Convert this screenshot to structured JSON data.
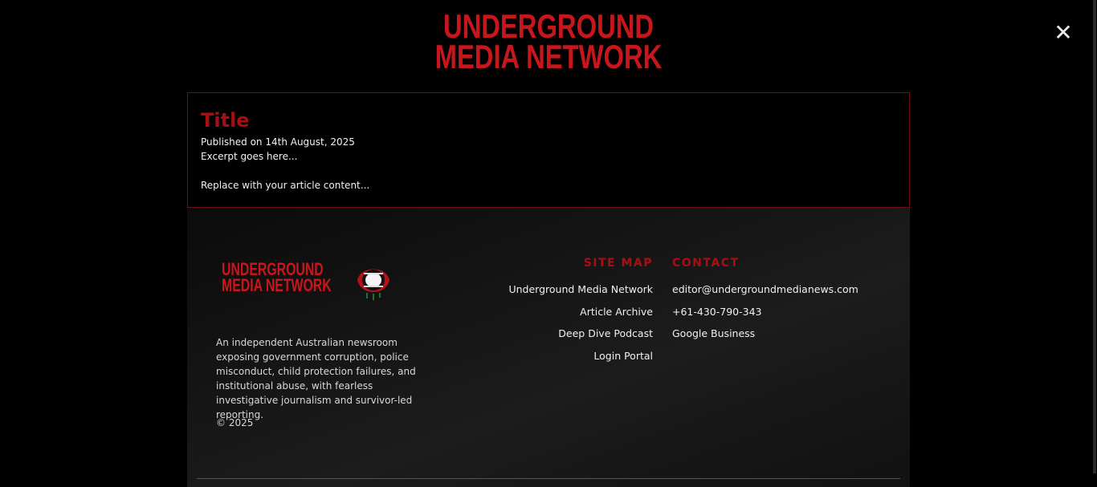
{
  "header": {
    "brand_line1": "UNDERGROUND",
    "brand_line2": "MEDIA NETWORK",
    "close_label": "✕"
  },
  "article": {
    "title": "Title",
    "published": "Published on 14th August, 2025",
    "excerpt": "Excerpt goes here...",
    "content": "Replace with your article content..."
  },
  "footer": {
    "logo_line1": "UNDERGROUND",
    "logo_line2": "MEDIA NETWORK",
    "about": "An independent Australian newsroom exposing government corruption, police misconduct, child protection failures, and institutional abuse, with fearless investigative journalism and survivor-led reporting.",
    "copyright": "© 2025",
    "sitemap": {
      "heading": "SITE MAP",
      "links": [
        "Underground Media Network",
        "Article Archive",
        "Deep Dive Podcast",
        "Login Portal"
      ]
    },
    "contact": {
      "heading": "CONTACT",
      "links": [
        "editor@undergroundmedianews.com",
        "+61-430-790-343",
        "Google Business"
      ]
    }
  },
  "colors": {
    "brand_red": "#c8161d",
    "heading_red": "#a80f14",
    "background": "#000000"
  },
  "icons": {
    "close": "close-icon",
    "mouth_logo": "mouth-logo-icon"
  }
}
